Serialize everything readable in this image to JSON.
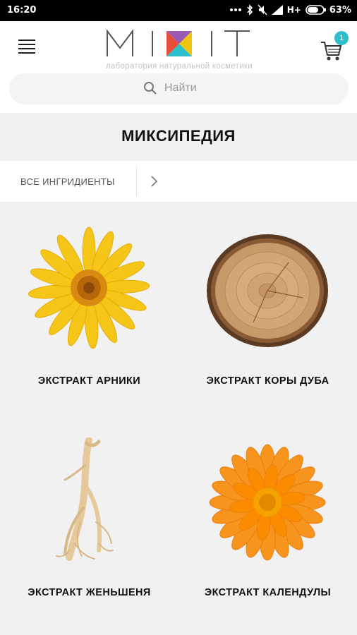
{
  "status_bar": {
    "time": "16:20",
    "network": "H+",
    "battery": "63%"
  },
  "header": {
    "logo_text": "MIXIT",
    "logo_tagline": "лаборатория натуральной косметики",
    "cart_count": "1",
    "brand_accent": "#2bbfcb"
  },
  "search": {
    "placeholder": "Найти"
  },
  "page": {
    "title": "МИКСИПЕДИЯ"
  },
  "breadcrumb": {
    "label": "ВСЕ ИНГРИДИЕНТЫ"
  },
  "ingredients": [
    {
      "name": "ЭКСТРАКТ АРНИКИ",
      "image": "arnica-flower"
    },
    {
      "name": "ЭКСТРАКТ КОРЫ ДУБА",
      "image": "oak-wood-slice"
    },
    {
      "name": "ЭКСТРАКТ ЖЕНЬШЕНЯ",
      "image": "ginseng-root"
    },
    {
      "name": "ЭКСТРАКТ КАЛЕНДУЛЫ",
      "image": "calendula-flower"
    }
  ]
}
